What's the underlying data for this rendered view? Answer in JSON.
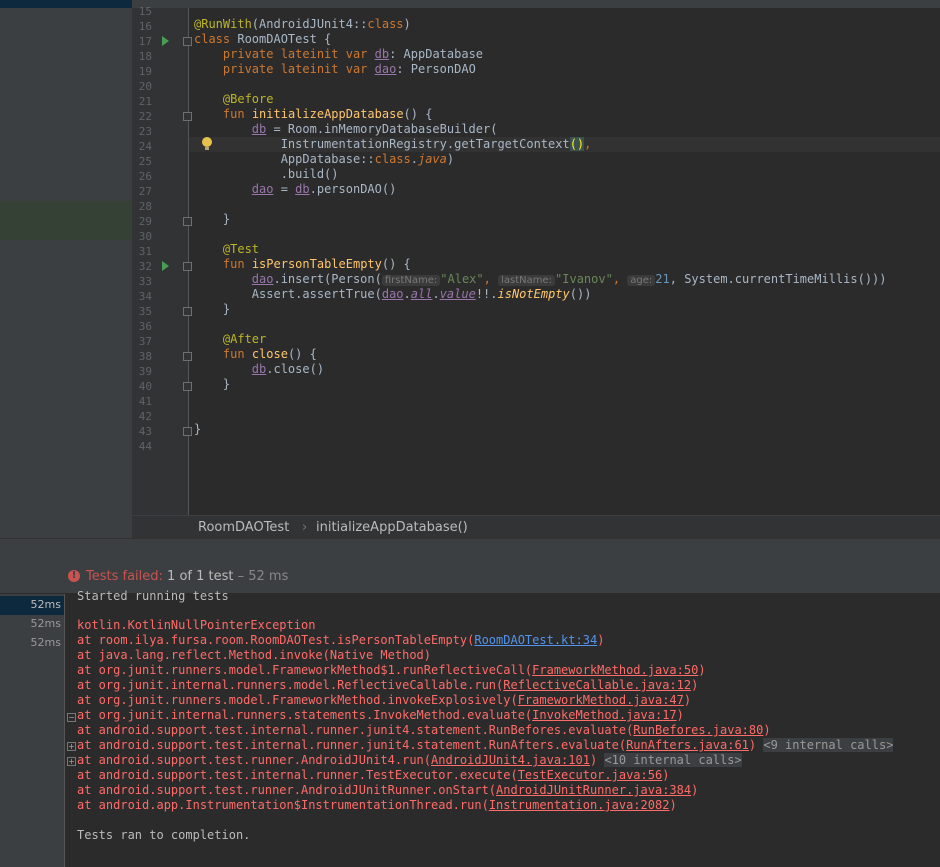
{
  "editor": {
    "lines": [
      {
        "n": "15"
      },
      {
        "n": "16"
      },
      {
        "n": "17"
      },
      {
        "n": "18"
      },
      {
        "n": "19"
      },
      {
        "n": "20"
      },
      {
        "n": "21"
      },
      {
        "n": "22"
      },
      {
        "n": "23"
      },
      {
        "n": "24"
      },
      {
        "n": "25"
      },
      {
        "n": "26"
      },
      {
        "n": "27"
      },
      {
        "n": "28"
      },
      {
        "n": "29"
      },
      {
        "n": "30"
      },
      {
        "n": "31"
      },
      {
        "n": "32"
      },
      {
        "n": "33"
      },
      {
        "n": "34"
      },
      {
        "n": "35"
      },
      {
        "n": "36"
      },
      {
        "n": "37"
      },
      {
        "n": "38"
      },
      {
        "n": "39"
      },
      {
        "n": "40"
      },
      {
        "n": "41"
      },
      {
        "n": "42"
      },
      {
        "n": "43"
      },
      {
        "n": "44"
      }
    ],
    "code": {
      "l16_ann": "@RunWith",
      "l16_rest": "(AndroidJUnit4::",
      "l16_kw": "class",
      "l16_end": ")",
      "l17_kw": "class",
      "l17_rest": " RoomDAOTest {",
      "l18_kw": "private lateinit var",
      "l18_prop": "db",
      "l18_rest": ": AppDatabase",
      "l19_kw": "private lateinit var",
      "l19_prop": "dao",
      "l19_rest": ": PersonDAO",
      "l21_ann": "@Before",
      "l22_kw": "fun",
      "l22_fn": "initializeAppDatabase",
      "l22_rest": "() {",
      "l23_prop": "db",
      "l23_rest": " = Room.inMemoryDatabaseBuilder(",
      "l24_rest": "InstrumentationRegistry.getTargetContext",
      "l24_paren": "()",
      "l24_comma": ",",
      "l25_rest": "AppDatabase::",
      "l25_kw": "class",
      "l25_dot": ".",
      "l25_it": "java",
      "l25_end": ")",
      "l26_rest": ".build()",
      "l27_prop1": "dao",
      "l27_mid": " = ",
      "l27_prop2": "db",
      "l27_rest": ".personDAO()",
      "l29_rest": "}",
      "l31_ann": "@Test",
      "l32_kw": "fun",
      "l32_fn": "isPersonTableEmpty",
      "l32_rest": "() {",
      "l33_prop": "dao",
      "l33_a": ".insert(Person(",
      "l33_h1": "firstName:",
      "l33_s1": "\"Alex\"",
      "l33_c1": ",",
      "l33_h2": "lastName:",
      "l33_s2": "\"Ivanov\"",
      "l33_c2": ",",
      "l33_h3": "age:",
      "l33_n": "21",
      "l33_rest": ", System.currentTimeMillis()))",
      "l34_a": "Assert.assertTrue(",
      "l34_prop": "dao",
      "l34_dot": ".",
      "l34_all": "all",
      "l34_dot2": ".",
      "l34_value": "value",
      "l34_bang": "!!.",
      "l34_fn": "isNotEmpty",
      "l34_end": "())",
      "l35_rest": "}",
      "l37_ann": "@After",
      "l38_kw": "fun",
      "l38_fn": "close",
      "l38_rest": "() {",
      "l39_prop": "db",
      "l39_rest": ".close()",
      "l40_rest": "}",
      "l43_rest": "}"
    }
  },
  "breadcrumb": {
    "cls": "RoomDAOTest",
    "sep": "›",
    "method": "initializeAppDatabase()"
  },
  "run": {
    "status_failed": "Tests failed:",
    "status_count": " 1 of 1 test",
    "status_dur": " – 52 ms",
    "tree": [
      "52ms",
      "52ms",
      "52ms"
    ],
    "console": {
      "started": "Started running tests",
      "exception": "kotlin.KotlinNullPointerException",
      "frames": [
        {
          "pre": "at room.ilya.fursa.room.RoomDAOTest.isPersonTableEmpty(",
          "link": "RoomDAOTest.kt:34",
          "post": ")"
        },
        {
          "pre": "at java.lang.reflect.Method.invoke(Native Method)",
          "link": "",
          "post": ""
        },
        {
          "pre": "at org.junit.runners.model.FrameworkMethod$1.runReflectiveCall(",
          "link": "FrameworkMethod.java:50",
          "post": ")"
        },
        {
          "pre": "at org.junit.internal.runners.model.ReflectiveCallable.run(",
          "link": "ReflectiveCallable.java:12",
          "post": ")"
        },
        {
          "pre": "at org.junit.runners.model.FrameworkMethod.invokeExplosively(",
          "link": "FrameworkMethod.java:47",
          "post": ")"
        },
        {
          "pre": "at org.junit.internal.runners.statements.InvokeMethod.evaluate(",
          "link": "InvokeMethod.java:17",
          "post": ")"
        },
        {
          "pre": "at android.support.test.internal.runner.junit4.statement.RunBefores.evaluate(",
          "link": "RunBefores.java:80",
          "post": ")"
        },
        {
          "pre": "at android.support.test.internal.runner.junit4.statement.RunAfters.evaluate(",
          "link": "RunAfters.java:61",
          "post": ")",
          "internal": "<9 internal calls>"
        },
        {
          "pre": "at android.support.test.runner.AndroidJUnit4.run(",
          "link": "AndroidJUnit4.java:101",
          "post": ")",
          "internal": "<10 internal calls>"
        },
        {
          "pre": "at android.support.test.internal.runner.TestExecutor.execute(",
          "link": "TestExecutor.java:56",
          "post": ")"
        },
        {
          "pre": "at android.support.test.runner.AndroidJUnitRunner.onStart(",
          "link": "AndroidJUnitRunner.java:384",
          "post": ")"
        },
        {
          "pre": "at android.app.Instrumentation$InstrumentationThread.run(",
          "link": "Instrumentation.java:2082",
          "post": ")"
        }
      ],
      "completed": "Tests ran to completion."
    }
  },
  "colors": {
    "keyword": "#cc7832",
    "annotation": "#bbb529",
    "function": "#ffc66d",
    "property": "#9876aa",
    "string": "#6a8759",
    "number": "#6897bb",
    "error": "#ff6b68"
  }
}
